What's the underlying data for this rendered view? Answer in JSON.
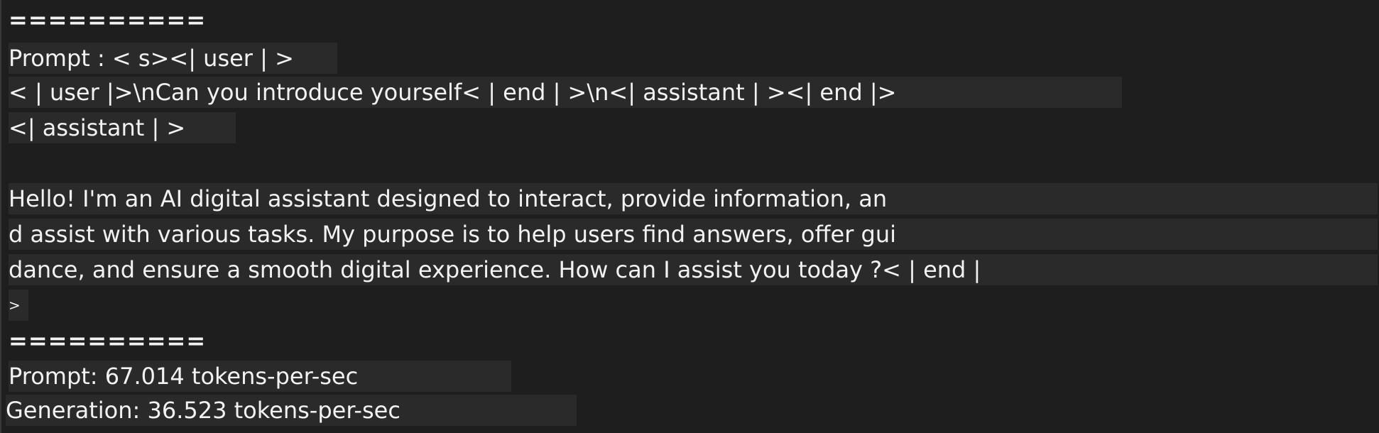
{
  "terminal": {
    "separator_top": "==========",
    "prompt_lines": [
      "Prompt : < s><| user | >",
      "< | user |>\\nCan you introduce yourself< | end | >\\n<| assistant | ><| end |>",
      "<| assistant | >"
    ],
    "response_lines": [
      "Hello! I'm an AI digital assistant designed to interact, provide information, an",
      "d assist with various tasks. My purpose is to help users find answers, offer gui",
      "dance, and ensure a smooth digital experience. How can I assist you today ?< | end |",
      ">"
    ],
    "separator_bottom": "==========",
    "stats": {
      "prompt": "Prompt: 67.014 tokens-per-sec",
      "generation": "Generation: 36.523 tokens-per-sec"
    }
  }
}
